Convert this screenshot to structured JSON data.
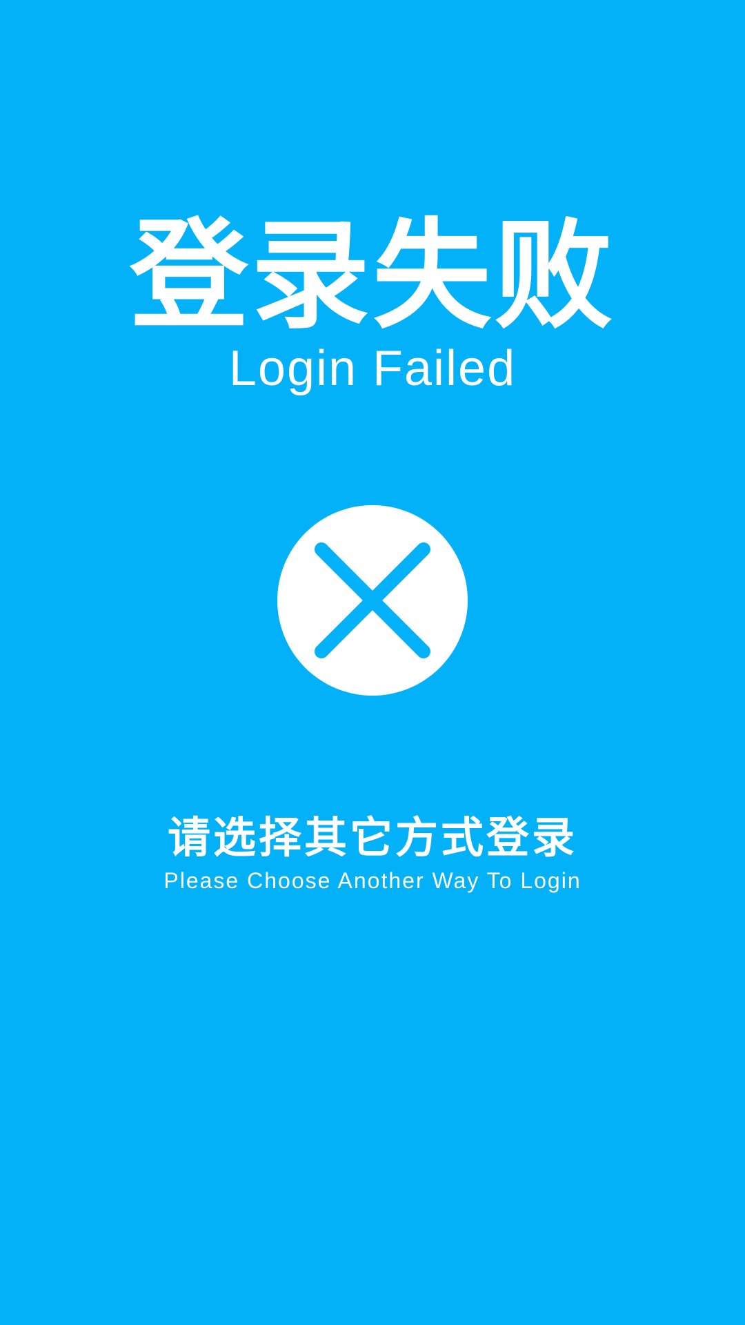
{
  "screen": {
    "background_color": "#02b1f8",
    "foreground_color": "#ffffff"
  },
  "title": {
    "zh": "登录失败",
    "en": "Login Failed"
  },
  "status_icon": {
    "name": "close-icon",
    "glyph": "×"
  },
  "hint": {
    "zh": "请选择其它方式登录",
    "en": "Please Choose Another Way To Login"
  }
}
